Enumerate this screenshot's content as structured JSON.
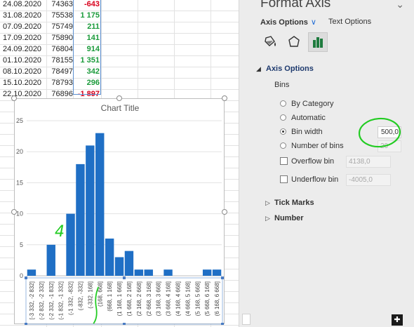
{
  "sheet": {
    "rows": [
      {
        "date": "24.08.2020",
        "value": "74363",
        "diff": "-643",
        "sign": "neg"
      },
      {
        "date": "31.08.2020",
        "value": "75538",
        "diff": "1 175",
        "sign": "pos"
      },
      {
        "date": "07.09.2020",
        "value": "75749",
        "diff": "211",
        "sign": "pos"
      },
      {
        "date": "17.09.2020",
        "value": "75890",
        "diff": "141",
        "sign": "pos"
      },
      {
        "date": "24.09.2020",
        "value": "76804",
        "diff": "914",
        "sign": "pos"
      },
      {
        "date": "01.10.2020",
        "value": "78155",
        "diff": "1 351",
        "sign": "pos"
      },
      {
        "date": "08.10.2020",
        "value": "78497",
        "diff": "342",
        "sign": "pos"
      },
      {
        "date": "15.10.2020",
        "value": "78793",
        "diff": "296",
        "sign": "pos"
      },
      {
        "date": "22.10.2020",
        "value": "76896",
        "diff": "-1 897",
        "sign": "neg"
      }
    ],
    "colors": {
      "positive": "#1a9a3a",
      "negative": "#d9001b",
      "selection": "#5b8fd0"
    }
  },
  "chart_data": {
    "type": "bar",
    "title": "Chart Title",
    "xlabel": "",
    "ylabel": "",
    "ylim": [
      0,
      25
    ],
    "yticks": [
      0,
      5,
      10,
      15,
      20,
      25
    ],
    "grid": true,
    "bar_color": "#1f6fc5",
    "categories": [
      "[-3 332, -2 832]",
      "(-2 832, -2 332]",
      "(-2 332, -1 832]",
      "(-1 832, -1 332]",
      "(-1 332, -832]",
      "(-832, -332]",
      "(-332, 168]",
      "(168, 668]",
      "(668, 1 168]",
      "(1 168, 1 668]",
      "(1 668, 2 168]",
      "(2 168, 2 668]",
      "(2 668, 3 168]",
      "(3 168, 3 668]",
      "(3 668, 4 168]",
      "(4 168, 4 668]",
      "(4 668, 5 168]",
      "(5 168, 5 668]",
      "(5 668, 6 168]",
      "(6 168, 6 668]"
    ],
    "values": [
      1,
      0,
      5,
      0,
      10,
      18,
      21,
      23,
      6,
      3,
      4,
      1,
      1,
      0,
      1,
      0,
      0,
      0,
      1,
      1
    ]
  },
  "annotations": {
    "handwritten_four": "4",
    "highlight_color": "#22cc22"
  },
  "pane": {
    "title": "Format Axis",
    "close_icon": "⌄",
    "tab_axis_options": "Axis Options",
    "tab_text_options": "Text Options",
    "section_axis_options": "Axis Options",
    "bins_label": "Bins",
    "by_category": "By Category",
    "automatic": "Automatic",
    "bin_width": "Bin width",
    "bin_width_value": "500,0",
    "number_of_bins": "Number of bins",
    "number_of_bins_value": "20",
    "overflow_bin": "Overflow bin",
    "overflow_value": "4138,0",
    "underflow_bin": "Underflow bin",
    "underflow_value": "-4005,0",
    "tick_marks": "Tick Marks",
    "number": "Number",
    "selected_bins_option": "bin_width"
  }
}
